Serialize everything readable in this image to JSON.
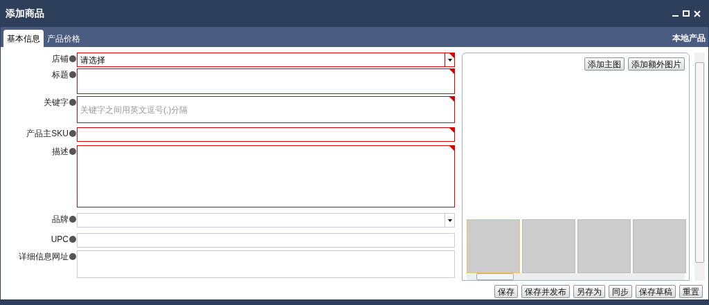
{
  "window": {
    "title": "添加商品"
  },
  "tabs": [
    {
      "label": "基本信息",
      "selected": true
    },
    {
      "label": "产品价格",
      "selected": false
    }
  ],
  "tab_bar_right": "本地产品",
  "fields": [
    {
      "label": "店铺",
      "kind": "select",
      "required": true,
      "value": "请选择"
    },
    {
      "label": "标题",
      "kind": "textarea",
      "required": true
    },
    {
      "label": "关键字",
      "kind": "textarea",
      "required": true,
      "placeholder": "关键字之间用英文逗号(,)分隔"
    },
    {
      "label": "产品主SKU",
      "kind": "text",
      "required": true
    },
    {
      "label": "描述",
      "kind": "textarea",
      "required": true
    },
    {
      "label": "品牌",
      "kind": "select",
      "required": false
    },
    {
      "label": "UPC",
      "kind": "text",
      "required": false
    },
    {
      "label": "详细信息网址",
      "kind": "textarea",
      "required": false
    }
  ],
  "image_panel": {
    "buttons": [
      "添加主图",
      "添加额外图片"
    ],
    "thumbnails": [
      {
        "selected": true
      },
      {
        "selected": false
      },
      {
        "selected": false
      },
      {
        "selected": false
      }
    ]
  },
  "footer_buttons": [
    "保存",
    "保存并发布",
    "另存为",
    "同步",
    "保存草稿",
    "重置"
  ]
}
